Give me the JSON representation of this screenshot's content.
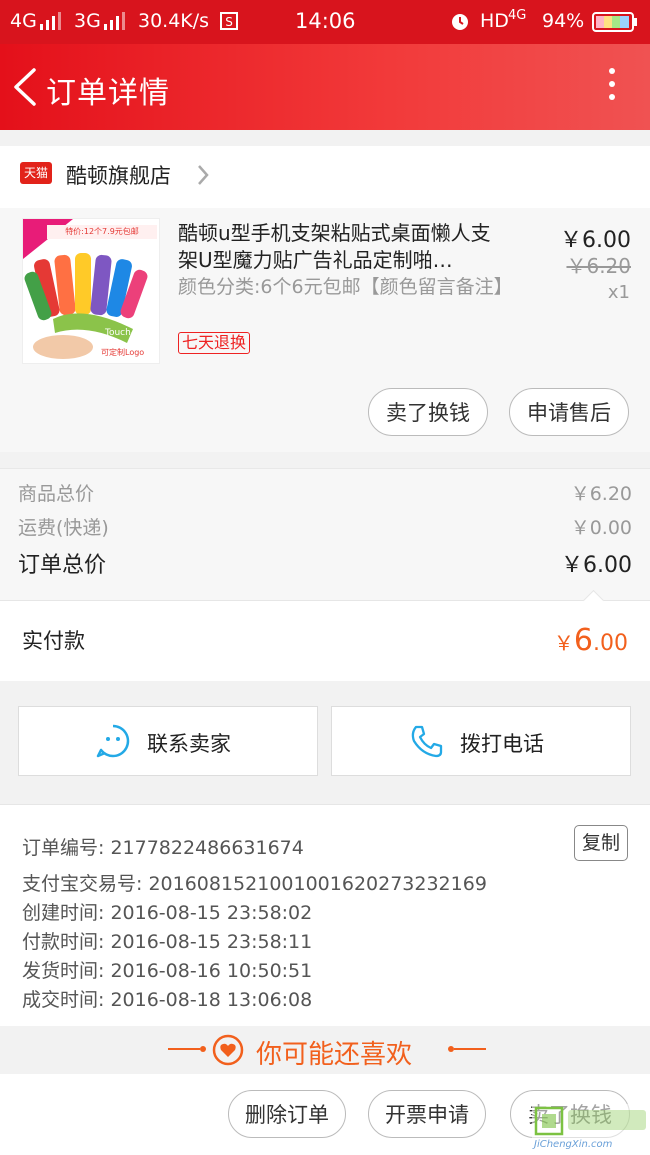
{
  "status_bar": {
    "net1": "4G",
    "net2": "3G",
    "speed": "30.4K/s",
    "time": "14:06",
    "hd": "HD",
    "net3": "4G",
    "battery": "94%"
  },
  "header": {
    "title": "订单详情"
  },
  "shop": {
    "badge": "天猫",
    "name": "酷顿旗舰店"
  },
  "product": {
    "title": "酷顿u型手机支架粘贴式桌面懒人支架U型魔力贴广告礼品定制啪…",
    "sku": "颜色分类:6个6元包邮【颜色留言备注】",
    "return_badge": "七天退换",
    "price": "￥6.00",
    "original_price": "￥6.20",
    "quantity": "x1",
    "thumb_banner": "特价:12个7.9元包邮",
    "thumb_logo_text": "可定制Logo",
    "thumb_touch": "Touch-U"
  },
  "product_actions": {
    "sell": "卖了换钱",
    "after_sale": "申请售后"
  },
  "totals": {
    "goods_label": "商品总价",
    "goods_value": "￥6.20",
    "shipping_label": "运费(快递)",
    "shipping_value": "￥0.00",
    "order_label": "订单总价",
    "order_value": "￥6.00",
    "paid_label": "实付款",
    "paid_currency": "￥",
    "paid_int": "6",
    "paid_dec": ".00"
  },
  "contact": {
    "seller": "联系卖家",
    "phone": "拨打电话"
  },
  "order_info": {
    "order_no": "订单编号: 2177822486631674",
    "alipay_no": "支付宝交易号: 2016081521001001620273232169",
    "created": "创建时间: 2016-08-15 23:58:02",
    "paid": "付款时间: 2016-08-15 23:58:11",
    "shipped": "发货时间: 2016-08-16 10:50:51",
    "completed": "成交时间: 2016-08-18 13:06:08",
    "copy": "复制"
  },
  "recommend": {
    "title": "你可能还喜欢"
  },
  "bottom_bar": {
    "delete": "删除订单",
    "invoice": "开票申请",
    "sell": "卖了换钱"
  },
  "watermark": {
    "brand": "JiChengXin.com"
  },
  "colors": {
    "brand_red": "#d8141d",
    "accent_orange": "#f2601d"
  }
}
